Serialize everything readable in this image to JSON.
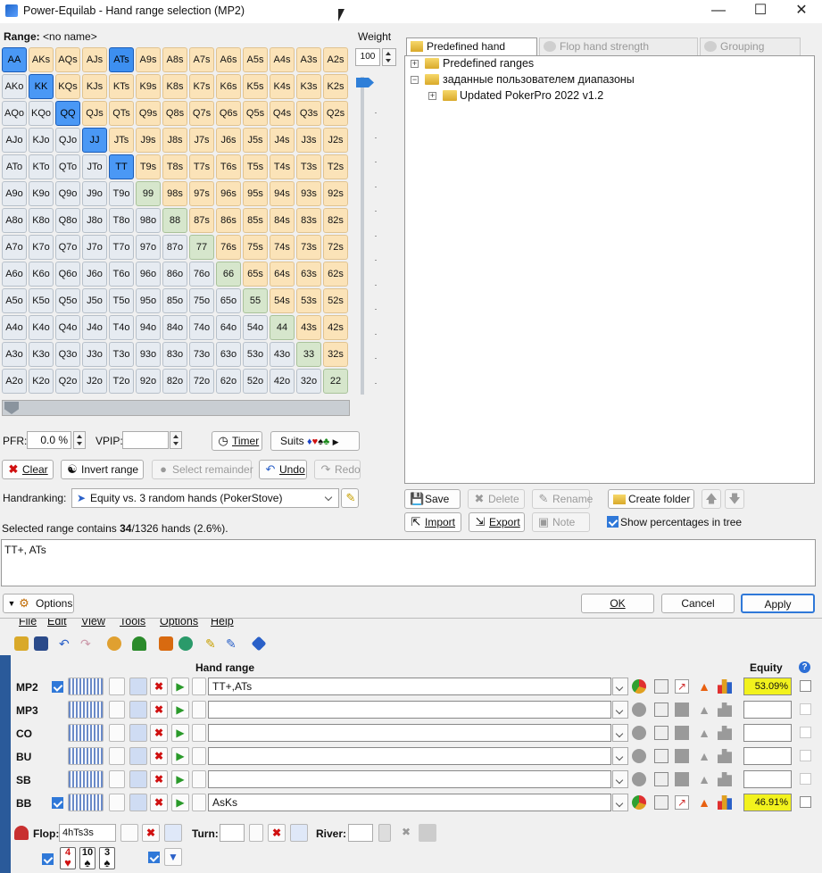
{
  "window": {
    "title": "Power-Equilab - Hand range selection (MP2)"
  },
  "range": {
    "label": "Range:",
    "name": "<no name>"
  },
  "grid": {
    "ranks": [
      "A",
      "K",
      "Q",
      "J",
      "T",
      "9",
      "8",
      "7",
      "6",
      "5",
      "4",
      "3",
      "2"
    ],
    "selected": [
      "AA",
      "KK",
      "QQ",
      "JJ",
      "TT",
      "ATs"
    ]
  },
  "weight": {
    "label": "Weight",
    "value": "100"
  },
  "tabs": [
    "Predefined hand ranges",
    "Flop hand strength distribution",
    "Grouping options"
  ],
  "tree": {
    "root": "Predefined ranges",
    "user": "заданные пользователем диапазоны",
    "child": "Updated PokerPro 2022 v1.2"
  },
  "stats": {
    "pfr_label": "PFR:",
    "pfr_value": "0.0 %",
    "vpip_label": "VPIP:",
    "vpip_value": ""
  },
  "buttons": {
    "timer": "Timer",
    "suits": "Suits",
    "clear": "Clear",
    "invert": "Invert range",
    "select_remainder": "Select remainder",
    "undo": "Undo",
    "redo": "Redo",
    "save": "Save",
    "delete": "Delete",
    "rename": "Rename",
    "create_folder": "Create folder",
    "import": "Import",
    "export": "Export",
    "note": "Note",
    "show_pct": "Show percentages in tree",
    "options": "Options",
    "ok": "OK",
    "cancel": "Cancel",
    "apply": "Apply"
  },
  "handranking": {
    "label": "Handranking:",
    "value": "Equity vs. 3 random hands (PokerStove)"
  },
  "summary": {
    "prefix": "Selected range contains ",
    "count": "34",
    "suffix": "/1326 hands (2.6%)."
  },
  "range_text": "TT+, ATs",
  "menu": [
    "File",
    "Edit",
    "View",
    "Tools",
    "Options",
    "Help"
  ],
  "table": {
    "hand_range_header": "Hand range",
    "equity_header": "Equity",
    "help_glyph": "?",
    "players": [
      {
        "name": "MP2",
        "checked": true,
        "range": "TT+,ATs",
        "equity": "53.09%",
        "active": true
      },
      {
        "name": "MP3",
        "checked": false,
        "range": "",
        "equity": "",
        "active": false
      },
      {
        "name": "CO",
        "checked": false,
        "range": "",
        "equity": "",
        "active": false
      },
      {
        "name": "BU",
        "checked": false,
        "range": "",
        "equity": "",
        "active": false
      },
      {
        "name": "SB",
        "checked": false,
        "range": "",
        "equity": "",
        "active": false
      },
      {
        "name": "BB",
        "checked": true,
        "range": "AsKs",
        "equity": "46.91%",
        "active": true
      }
    ]
  },
  "board": {
    "flop_label": "Flop:",
    "flop_value": "4hTs3s",
    "turn_label": "Turn:",
    "turn_value": "",
    "river_label": "River:",
    "river_value": "",
    "cards": [
      {
        "rank": "4",
        "suit": "♥",
        "color": "#d01010"
      },
      {
        "rank": "10",
        "suit": "♠",
        "color": "#111111"
      },
      {
        "rank": "3",
        "suit": "♠",
        "color": "#111111"
      }
    ]
  },
  "colors": {
    "suited": "#fbe3b8",
    "offsuit": "#e6ebf1",
    "pair": "#d6e6cc",
    "selected": "#3d8ff0",
    "equity_highlight": "#f2f21d"
  }
}
